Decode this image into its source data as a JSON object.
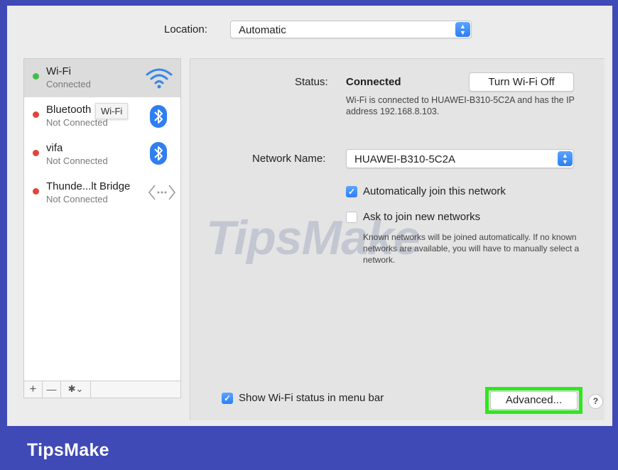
{
  "location": {
    "label": "Location:",
    "value": "Automatic"
  },
  "sidebar": {
    "services": [
      {
        "name": "Wi-Fi",
        "status": "Connected",
        "dot_color": "#3fbf4a",
        "icon": "wifi-icon"
      },
      {
        "name": "Bluetooth",
        "status": "Not Connected",
        "dot_color": "#e0443c",
        "icon": "bluetooth-icon"
      },
      {
        "name": "vifa",
        "status": "Not Connected",
        "dot_color": "#e0443c",
        "icon": "bluetooth-icon"
      },
      {
        "name": "Thunde...lt Bridge",
        "status": "Not Connected",
        "dot_color": "#e0443c",
        "icon": "thunderbolt-bridge-icon"
      }
    ],
    "tooltip": "Wi-Fi",
    "toolbar": {
      "add": "+",
      "remove": "—",
      "gear": "✱⌄"
    }
  },
  "detail": {
    "status_label": "Status:",
    "status_value": "Connected",
    "turn_off_button": "Turn Wi-Fi Off",
    "status_description": "Wi-Fi is connected to HUAWEI-B310-5C2A and has the IP address 192.168.8.103.",
    "network_name_label": "Network Name:",
    "network_name_value": "HUAWEI-B310-5C2A",
    "auto_join": {
      "label": "Automatically join this network",
      "checked": true
    },
    "ask_join": {
      "label": "Ask to join new networks",
      "checked": false
    },
    "ask_join_hint": "Known networks will be joined automatically. If no known networks are available, you will have to manually select a network.",
    "show_status": {
      "label": "Show Wi-Fi status in menu bar",
      "checked": true
    },
    "advanced_button": "Advanced...",
    "help_button": "?"
  },
  "watermark": "TipsMake",
  "footer": {
    "brand": "TipsMake"
  },
  "colors": {
    "frame": "#3f4ab6",
    "highlight": "#2ee81d",
    "accent": "#2f7ef2"
  }
}
